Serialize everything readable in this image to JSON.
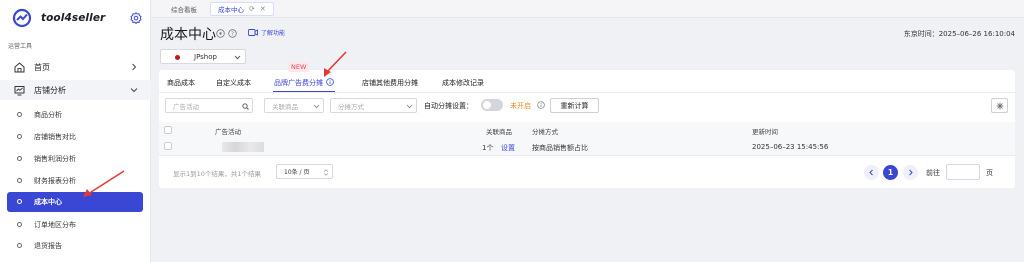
{
  "app": {
    "name": "tool4seller"
  },
  "sidebar": {
    "section_label": "运营工具",
    "home": {
      "label": "首页",
      "icon": "home-icon"
    },
    "group": {
      "label": "店铺分析",
      "icon": "chart-icon"
    },
    "sub_items": [
      {
        "label": "商品分析"
      },
      {
        "label": "店铺销售对比"
      },
      {
        "label": "销售利润分析"
      },
      {
        "label": "财务报表分析"
      },
      {
        "label": "成本中心",
        "active": true
      },
      {
        "label": "订单地区分布"
      },
      {
        "label": "退货报告"
      }
    ]
  },
  "tabs": [
    {
      "label": "综合看板"
    },
    {
      "label": "成本中心",
      "active": true
    }
  ],
  "header": {
    "title": "成本中心",
    "learn_label": "了解功能",
    "time_text": "东京时间：2025–06–26 16:10:04"
  },
  "shop": {
    "name": "JPshop"
  },
  "sub_tabs": [
    {
      "label": "商品成本"
    },
    {
      "label": "自定义成本"
    },
    {
      "label": "品牌广告费分摊",
      "active": true,
      "badge": "NEW"
    },
    {
      "label": "店铺其他费用分摊"
    },
    {
      "label": "成本修改记录"
    }
  ],
  "filters": {
    "ad_placeholder": "广告活动",
    "product_placeholder": "关联商品",
    "method_placeholder": "分摊方式",
    "auto_label": "自动分摊设置：",
    "auto_state": "未开启",
    "recalc_label": "重新计算"
  },
  "table": {
    "columns": [
      "广告活动",
      "关联商品",
      "分摊方式",
      "更新时间"
    ],
    "rows": [
      {
        "product_count": "1个",
        "action": "设置",
        "method": "按商品销售额占比",
        "updated": "2025–06–23 15:45:56"
      }
    ]
  },
  "pagination": {
    "info": "显示1到10个结果，共1个结果",
    "page_size": "10条 / 页",
    "current_page": "1",
    "goto_label": "前往",
    "goto_unit": "页"
  },
  "colors": {
    "primary": "#3a47d5",
    "warning": "#f08a1c",
    "badge": "#e8445a"
  }
}
